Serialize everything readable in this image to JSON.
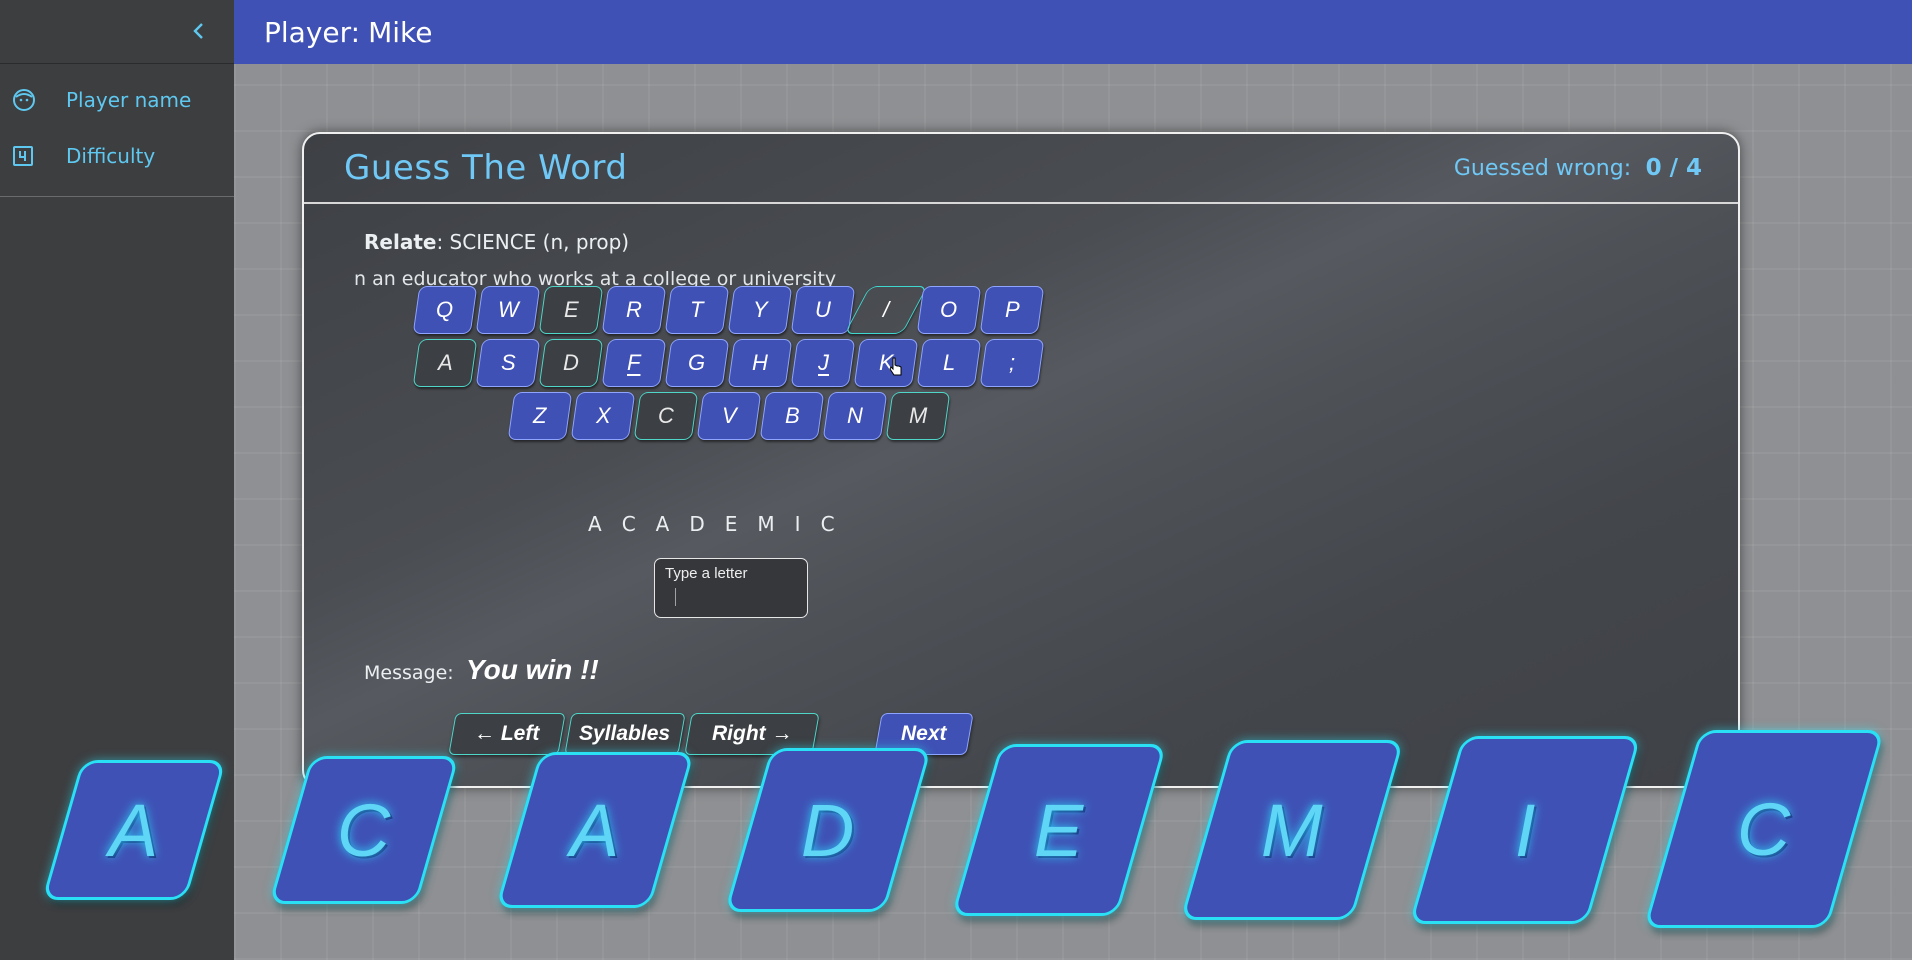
{
  "sidebar": {
    "collapse_icon": "chevron-left-icon",
    "items": [
      {
        "label": "Player name",
        "icon": "face-icon"
      },
      {
        "label": "Difficulty",
        "icon": "number-4-box-icon"
      }
    ]
  },
  "header": {
    "player_label": "Player:",
    "player_name": "Mike"
  },
  "game": {
    "title": "Guess The Word",
    "wrong_label": "Guessed wrong:",
    "wrong_value": "0 / 4",
    "relate_label": "Relate",
    "relate_value": ": SCIENCE (n, prop)",
    "definition": "n an educator who works at a college or university",
    "keyboard": {
      "row1": [
        "Q",
        "W",
        "E",
        "R",
        "T",
        "Y",
        "U",
        "/",
        "O",
        "P"
      ],
      "row2": [
        "A",
        "S",
        "D",
        "F",
        "G",
        "H",
        "J",
        "K",
        "L",
        ";"
      ],
      "row3": [
        "Z",
        "X",
        "C",
        "V",
        "B",
        "N",
        "M"
      ]
    },
    "revealed_letters": [
      "A",
      "C",
      "A",
      "D",
      "E",
      "M",
      "I",
      "C"
    ],
    "input": {
      "label": "Type a letter",
      "value": ""
    },
    "message_label": "Message:",
    "message_text": "You win !!",
    "buttons": {
      "left": "← Left",
      "syllables": "Syllables",
      "right": "Right →",
      "next": "Next"
    }
  },
  "tiles": [
    "A",
    "C",
    "A",
    "D",
    "E",
    "M",
    "I",
    "C"
  ],
  "colors": {
    "header_bg": "#3f51b5",
    "accent": "#5ec8f0",
    "tile_glow": "#29e0f5",
    "sidebar_bg": "#3d3e40"
  }
}
